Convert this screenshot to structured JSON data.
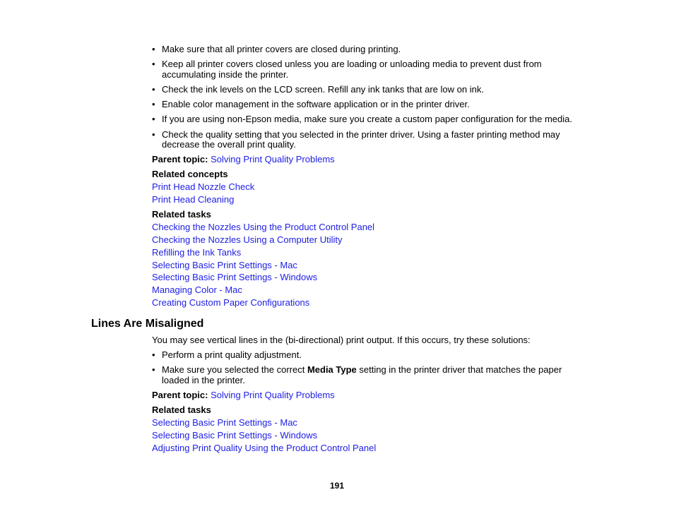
{
  "top_section": {
    "bullets": [
      {
        "lines": [
          "Make sure that all printer covers are closed during printing."
        ]
      },
      {
        "lines": [
          "Keep all printer covers closed unless you are loading or unloading media to prevent dust from",
          "accumulating inside the printer."
        ]
      },
      {
        "lines": [
          "Check the ink levels on the LCD screen. Refill any ink tanks that are low on ink."
        ]
      },
      {
        "lines": [
          "Enable color management in the software application or in the printer driver."
        ]
      },
      {
        "lines": [
          "If you are using non-Epson media, make sure you create a custom paper configuration for the media."
        ]
      },
      {
        "lines": [
          "Check the quality setting that you selected in the printer driver. Using a faster printing method may",
          "decrease the overall print quality."
        ]
      }
    ],
    "bullet_glyph": "•",
    "parent_topic_label": "Parent topic:",
    "parent_topic_link": "Solving Print Quality Problems",
    "related_concepts_label": "Related concepts",
    "related_concepts": [
      "Print Head Nozzle Check",
      "Print Head Cleaning"
    ],
    "related_tasks_label": "Related tasks",
    "related_tasks": [
      "Checking the Nozzles Using the Product Control Panel",
      "Checking the Nozzles Using a Computer Utility",
      "Refilling the Ink Tanks",
      "Selecting Basic Print Settings - Mac",
      "Selecting Basic Print Settings - Windows",
      "Managing Color - Mac",
      "Creating Custom Paper Configurations"
    ]
  },
  "lines_section": {
    "heading": "Lines Are Misaligned",
    "intro": "You may see vertical lines in the (bi-directional) print output. If this occurs, try these solutions:",
    "bullet1": "Perform a print quality adjustment.",
    "bullet2_pre": "Make sure you selected the correct ",
    "bullet2_bold": "Media Type",
    "bullet2_post": " setting in the printer driver that matches the paper",
    "bullet2_line2": "loaded in the printer.",
    "parent_topic_label": "Parent topic:",
    "parent_topic_link": "Solving Print Quality Problems",
    "related_tasks_label": "Related tasks",
    "related_tasks": [
      "Selecting Basic Print Settings - Mac",
      "Selecting Basic Print Settings - Windows",
      "Adjusting Print Quality Using the Product Control Panel"
    ]
  },
  "page_number": "191",
  "colors": {
    "link": "#2020e6",
    "text": "#000000"
  }
}
